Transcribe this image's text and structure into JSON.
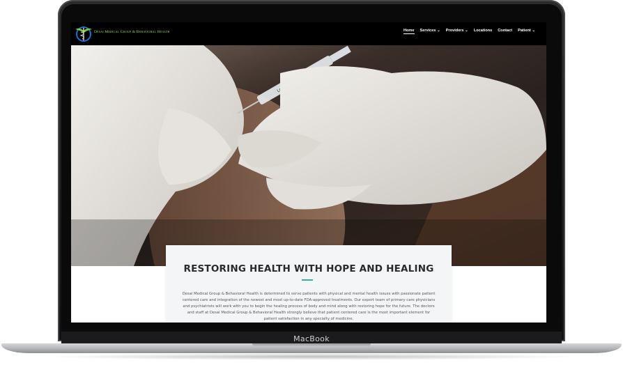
{
  "device": {
    "brand_label": "MacBook"
  },
  "site": {
    "logo_text": "Desai Medical Group & Behavioral Health",
    "nav": {
      "home": "Home",
      "services": "Services",
      "providers": "Providers",
      "locations": "Locations",
      "contact": "Contact",
      "patient": "Patient",
      "dropdown_glyph": "⌄"
    },
    "hero": {
      "image_icon": "vaccine-injection-photo"
    },
    "intro": {
      "title": "RESTORING HEALTH WITH HOPE AND HEALING",
      "body": "Desai Medical Group & Behavioral Health is determined to serve patients with physical and mental health issues with passionate patient centered care and integration of the newest and most up-to-date FDA-approved treatments. Our expert team of primary care physicians and psychiatrists will work with you to begin the healing process of body and mind along with restoring hope for the future. The doctors and staff at Desai Medical Group & Behavioral Health strongly believe that patient centered care is the most important element for patient satisfaction in any specialty of medicine."
    },
    "colors": {
      "nav_bg": "#000000",
      "logo_green": "#9be03a",
      "accent_teal": "#2fb39a",
      "glove_white": "#e9e6e2"
    }
  }
}
